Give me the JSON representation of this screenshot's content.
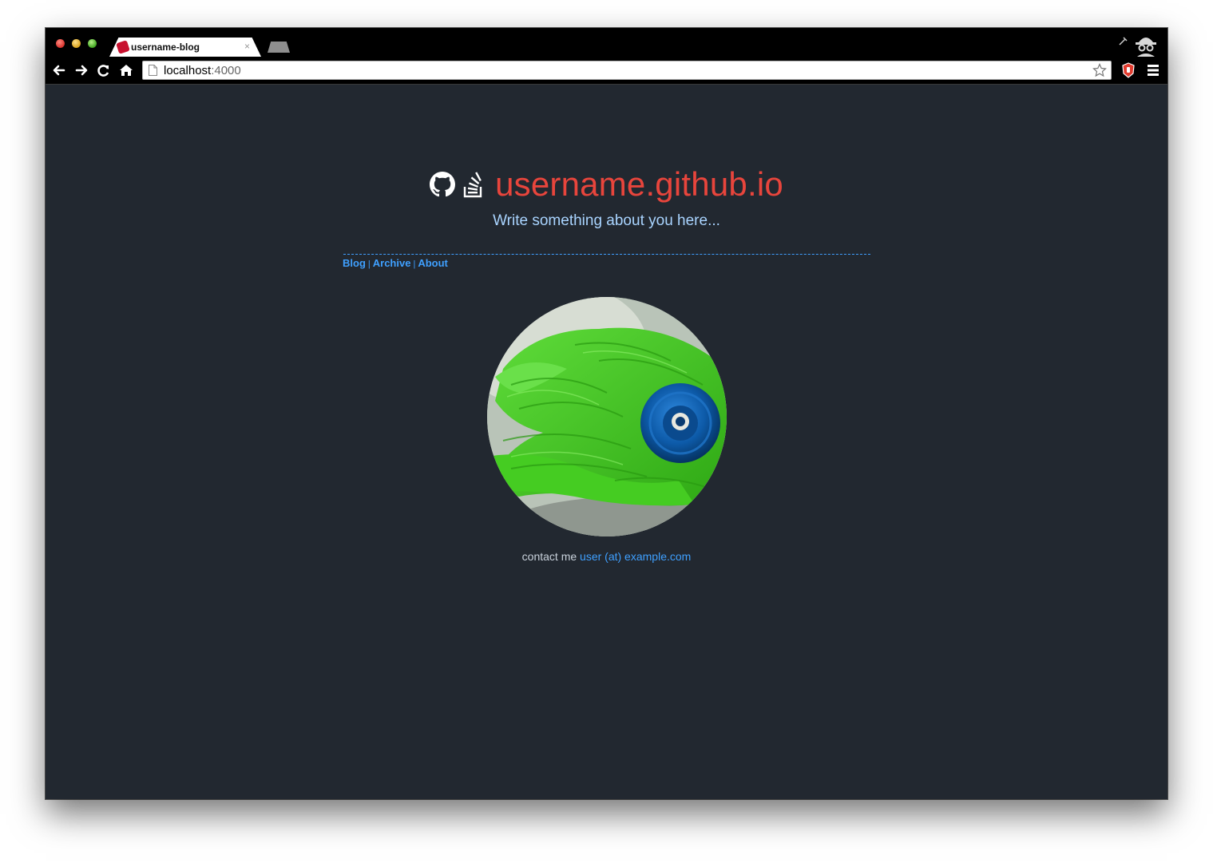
{
  "browser": {
    "tab": {
      "title": "username-blog",
      "close_glyph": "×"
    },
    "address": {
      "host": "localhost",
      "port": ":4000"
    }
  },
  "site": {
    "title": "username.github.io",
    "tagline": "Write something about you here...",
    "nav": [
      {
        "label": "Blog"
      },
      {
        "label": "Archive"
      },
      {
        "label": "About"
      }
    ],
    "nav_separator": "|",
    "contact": {
      "prefix": "contact me",
      "email": "user (at) example.com"
    }
  },
  "colors": {
    "page_background": "#222830",
    "title": "#e8453c",
    "tagline": "#a9d4ff",
    "link": "#3fa0ff",
    "yarn": "#3ec21a",
    "yoyo": "#0d5aa8"
  },
  "icons": {
    "github": "github-icon",
    "stackoverflow": "stackoverflow-icon",
    "back": "back-arrow-icon",
    "forward": "forward-arrow-icon",
    "reload": "reload-icon",
    "home": "home-icon",
    "bookmark": "star-icon",
    "menu": "hamburger-menu-icon",
    "incognito": "incognito-icon"
  }
}
